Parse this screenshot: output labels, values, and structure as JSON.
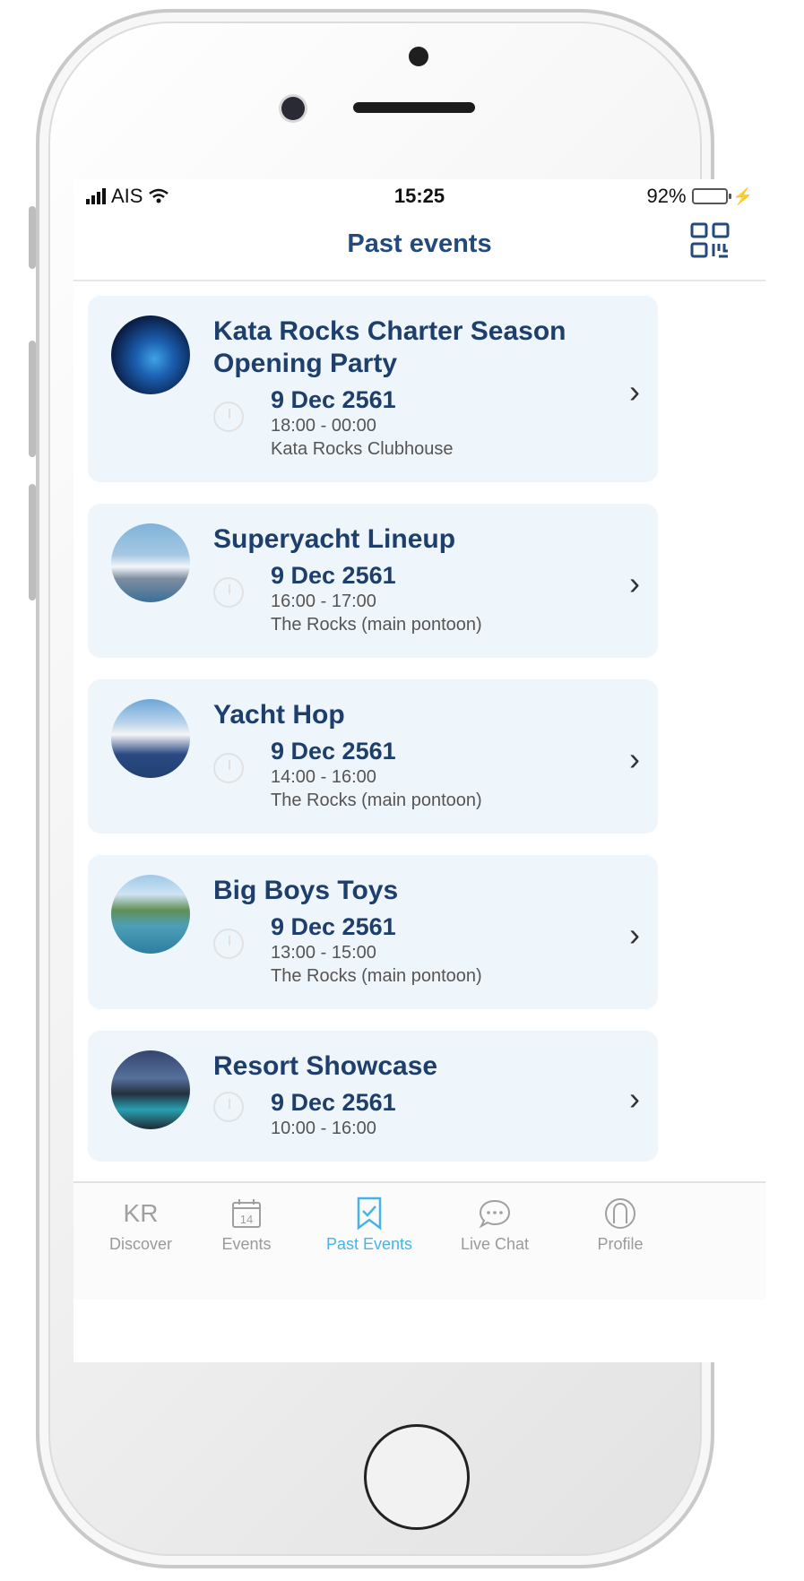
{
  "status": {
    "carrier": "AIS",
    "time": "15:25",
    "battery": "92%",
    "battery_level": 0.92
  },
  "header": {
    "title": "Past events",
    "qr_icon": "qr-code-icon"
  },
  "events": [
    {
      "title": "Kata Rocks Charter Season Opening Party",
      "date": "9 Dec 2561",
      "time": "18:00 - 00:00",
      "place": "Kata Rocks Clubhouse"
    },
    {
      "title": "Superyacht Lineup",
      "date": "9 Dec 2561",
      "time": "16:00 - 17:00",
      "place": "The Rocks (main pontoon)"
    },
    {
      "title": "Yacht Hop",
      "date": "9 Dec 2561",
      "time": "14:00 - 16:00",
      "place": "The Rocks (main pontoon)"
    },
    {
      "title": "Big Boys Toys",
      "date": "9 Dec 2561",
      "time": "13:00 - 15:00",
      "place": "The Rocks (main pontoon)"
    },
    {
      "title": "Resort Showcase",
      "date": "9 Dec 2561",
      "time": "10:00 - 16:00",
      "place": ""
    }
  ],
  "tabs": [
    {
      "label": "Discover",
      "icon": "kr-logo-icon",
      "icon_text": "KR"
    },
    {
      "label": "Events",
      "icon": "calendar-icon",
      "icon_text": "14"
    },
    {
      "label": "Past Events",
      "icon": "bookmark-check-icon"
    },
    {
      "label": "Live Chat",
      "icon": "chat-bubble-icon"
    },
    {
      "label": "Profile",
      "icon": "profile-icon"
    }
  ],
  "colors": {
    "title": "#234a7a",
    "card_bg": "#eef5fb",
    "active_tab": "#48b3e6",
    "battery": "#2fd158"
  }
}
